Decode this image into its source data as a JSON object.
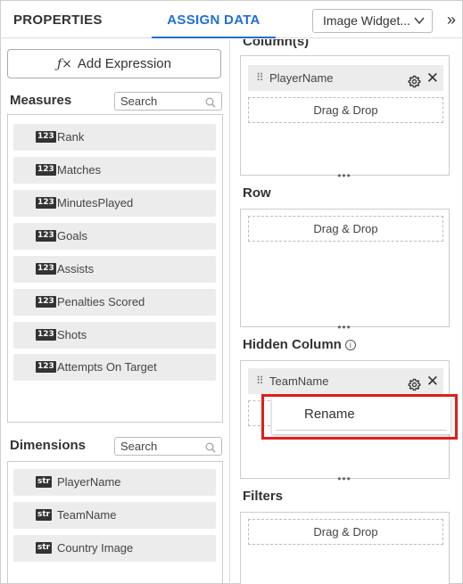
{
  "header": {
    "tab_properties": "PROPERTIES",
    "tab_assign_data": "ASSIGN DATA",
    "widget_select_value": "Image Widget...",
    "expand_glyph": "»",
    "accent_color": "#1f6fd6"
  },
  "left": {
    "add_expression_label": "Add Expression",
    "add_expression_glyph": "ƒ×",
    "measures": {
      "title": "Measures",
      "search_placeholder": "Search",
      "items": [
        {
          "badge": "123",
          "label": "Rank"
        },
        {
          "badge": "123",
          "label": "Matches"
        },
        {
          "badge": "123",
          "label": "MinutesPlayed"
        },
        {
          "badge": "123",
          "label": "Goals"
        },
        {
          "badge": "123",
          "label": "Assists"
        },
        {
          "badge": "123",
          "label": "Penalties Scored"
        },
        {
          "badge": "123",
          "label": "Shots"
        },
        {
          "badge": "123",
          "label": "Attempts On Target"
        }
      ]
    },
    "dimensions": {
      "title": "Dimensions",
      "search_placeholder": "Search",
      "items": [
        {
          "badge": "str",
          "label": "PlayerName"
        },
        {
          "badge": "str",
          "label": "TeamName"
        },
        {
          "badge": "str",
          "label": "Country Image"
        }
      ]
    }
  },
  "right": {
    "columns": {
      "title": "Column(s)",
      "item": "PlayerName",
      "drop_label": "Drag & Drop"
    },
    "row": {
      "title": "Row",
      "drop_label": "Drag & Drop"
    },
    "hidden_column": {
      "title": "Hidden Column",
      "item": "TeamName"
    },
    "filters": {
      "title": "Filters",
      "drop_label": "Drag & Drop"
    }
  },
  "context_menu": {
    "rename_label": "Rename",
    "highlight_color": "#e01c1c"
  }
}
